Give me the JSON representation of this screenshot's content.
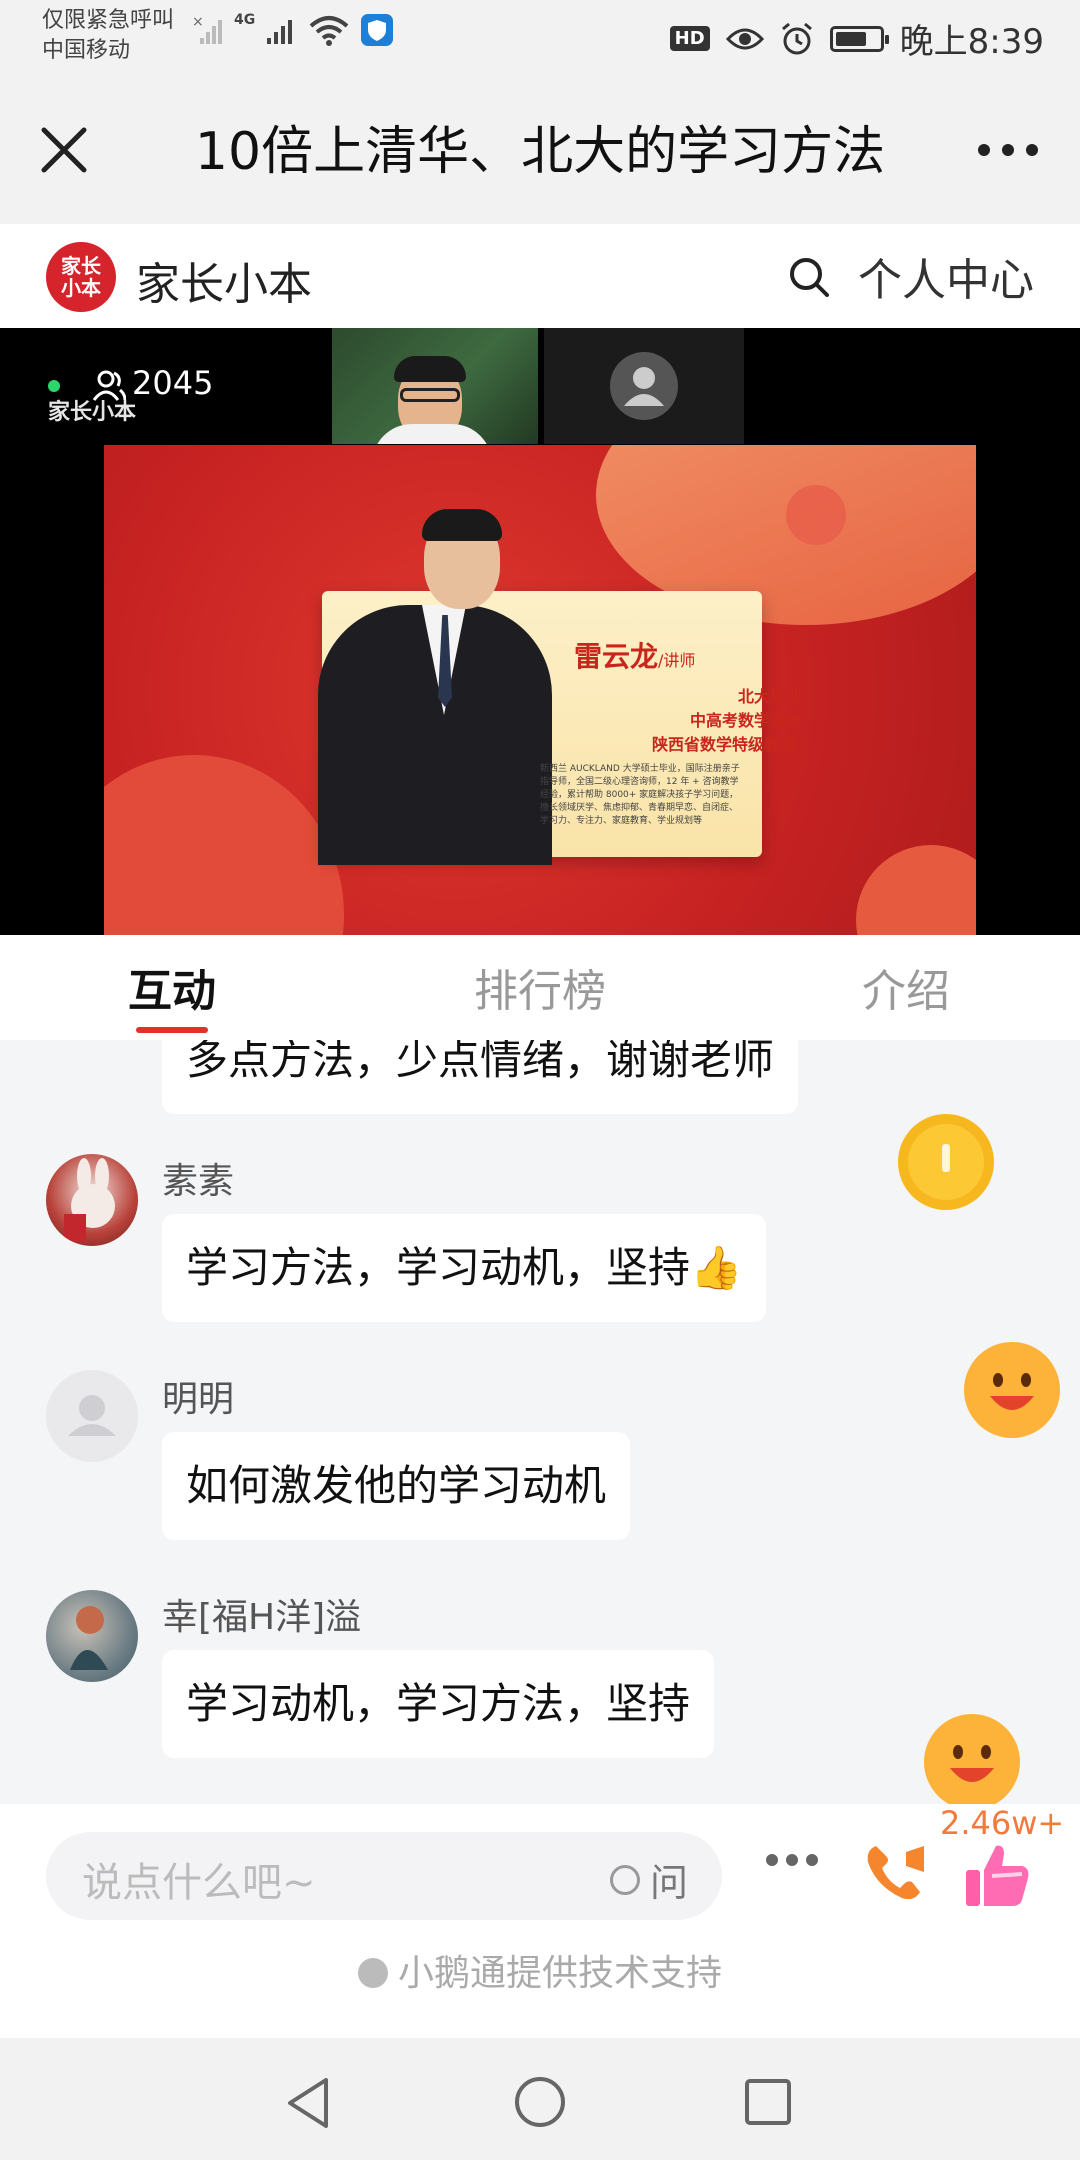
{
  "status_bar": {
    "notice": "仅限紧急呼叫",
    "carrier": "中国移动",
    "network": "4G",
    "hd": "HD",
    "time": "晚上8:39"
  },
  "titlebar": {
    "title": "10倍上清华、北大的学习方法"
  },
  "brand": {
    "logo_text": "家长小本",
    "name": "家长小本",
    "user_center": "个人中心"
  },
  "video": {
    "viewer_count": "2045",
    "watermark": "家长小本",
    "slide": {
      "teacher_name": "雷云龙",
      "teacher_role": "/讲师",
      "credentials": [
        "北大毕业",
        "中高考数学满分",
        "陕西省数学特级教师"
      ],
      "description": "新西兰 AUCKLAND 大学硕士毕业，国际注册亲子指导师，全国二级心理咨询师，12 年 + 咨询教学经验，累计帮助 8000+ 家庭解决孩子学习问题，擅长领域厌学、焦虑抑郁、青春期早恋、自闭症、学习力、专注力、家庭教育、学业规划等"
    }
  },
  "tabs": [
    {
      "label": "互动",
      "active": true
    },
    {
      "label": "排行榜",
      "active": false
    },
    {
      "label": "介绍",
      "active": false
    }
  ],
  "chat": {
    "messages": [
      {
        "nick": "",
        "text": "多点方法，少点情绪，谢谢老师"
      },
      {
        "nick": "素素",
        "text": "学习方法，学习动机，坚持👍"
      },
      {
        "nick": "明明",
        "text": "如何激发他的学习动机"
      },
      {
        "nick": "幸[福H洋]溢",
        "text": "学习动机，学习方法，坚持"
      }
    ]
  },
  "input_bar": {
    "placeholder": "说点什么吧~",
    "ask_label": "问",
    "like_count": "2.46w+",
    "powered_by": "小鹅通提供技术支持"
  },
  "colors": {
    "accent": "#e0322b",
    "like_orange": "#f27a3c",
    "logo_red": "#d6242c"
  }
}
